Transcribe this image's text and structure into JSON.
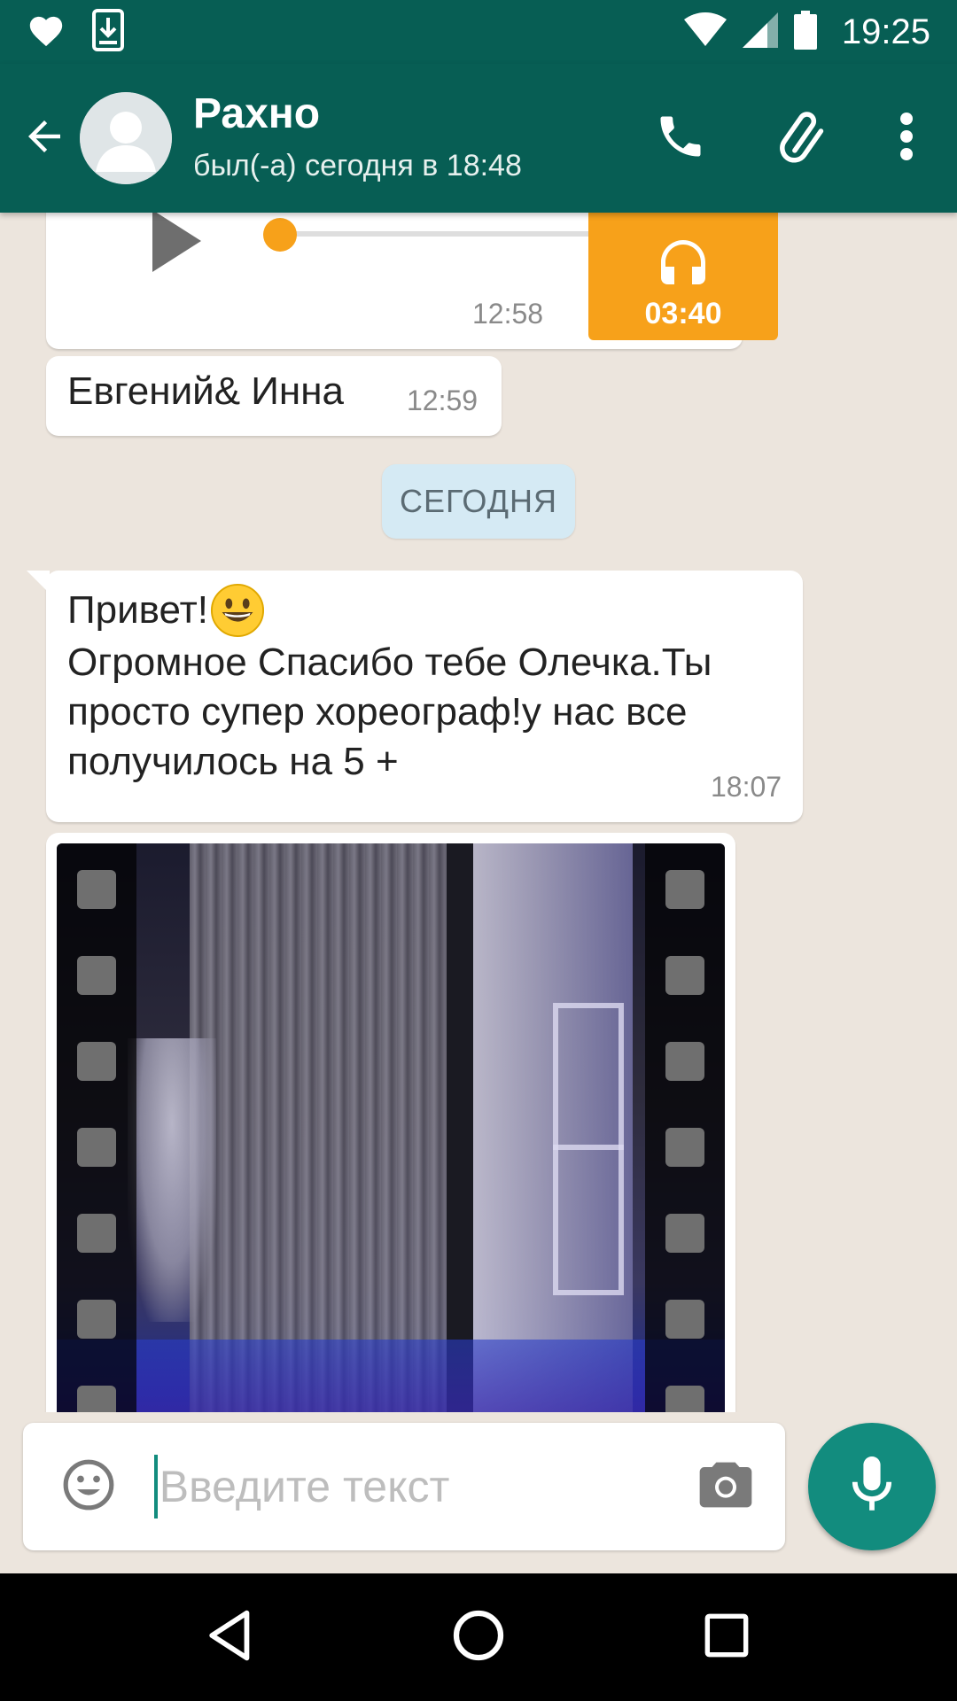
{
  "status_bar": {
    "time": "19:25",
    "icons": [
      "heart-icon",
      "download-icon",
      "wifi-icon",
      "signal-icon",
      "battery-icon"
    ]
  },
  "toolbar": {
    "contact_name": "Рахно",
    "contact_status": "был(-а) сегодня в 18:48",
    "icons": [
      "back-arrow-icon",
      "phone-icon",
      "paperclip-icon",
      "more-vert-icon"
    ]
  },
  "messages": {
    "audio": {
      "time": "12:58",
      "duration": "03:40",
      "progress": 0.05
    },
    "text1": {
      "text": "Евгений& Инна",
      "time": "12:59"
    },
    "date_separator": "СЕГОДНЯ",
    "text2": {
      "line1": "Привет!",
      "line2": "Огромное Спасибо тебе Олечка.Ты",
      "line3": "просто супер хореограф!у нас все",
      "line4": "получилось на 5 +",
      "time": "18:07"
    }
  },
  "input": {
    "placeholder": "Введите текст",
    "value": ""
  },
  "colors": {
    "primary": "#075e54",
    "accent": "#128c7e",
    "audio_orange": "#f7a11a",
    "chat_bg": "#ece5dd",
    "date_chip": "#d5eaf4"
  }
}
